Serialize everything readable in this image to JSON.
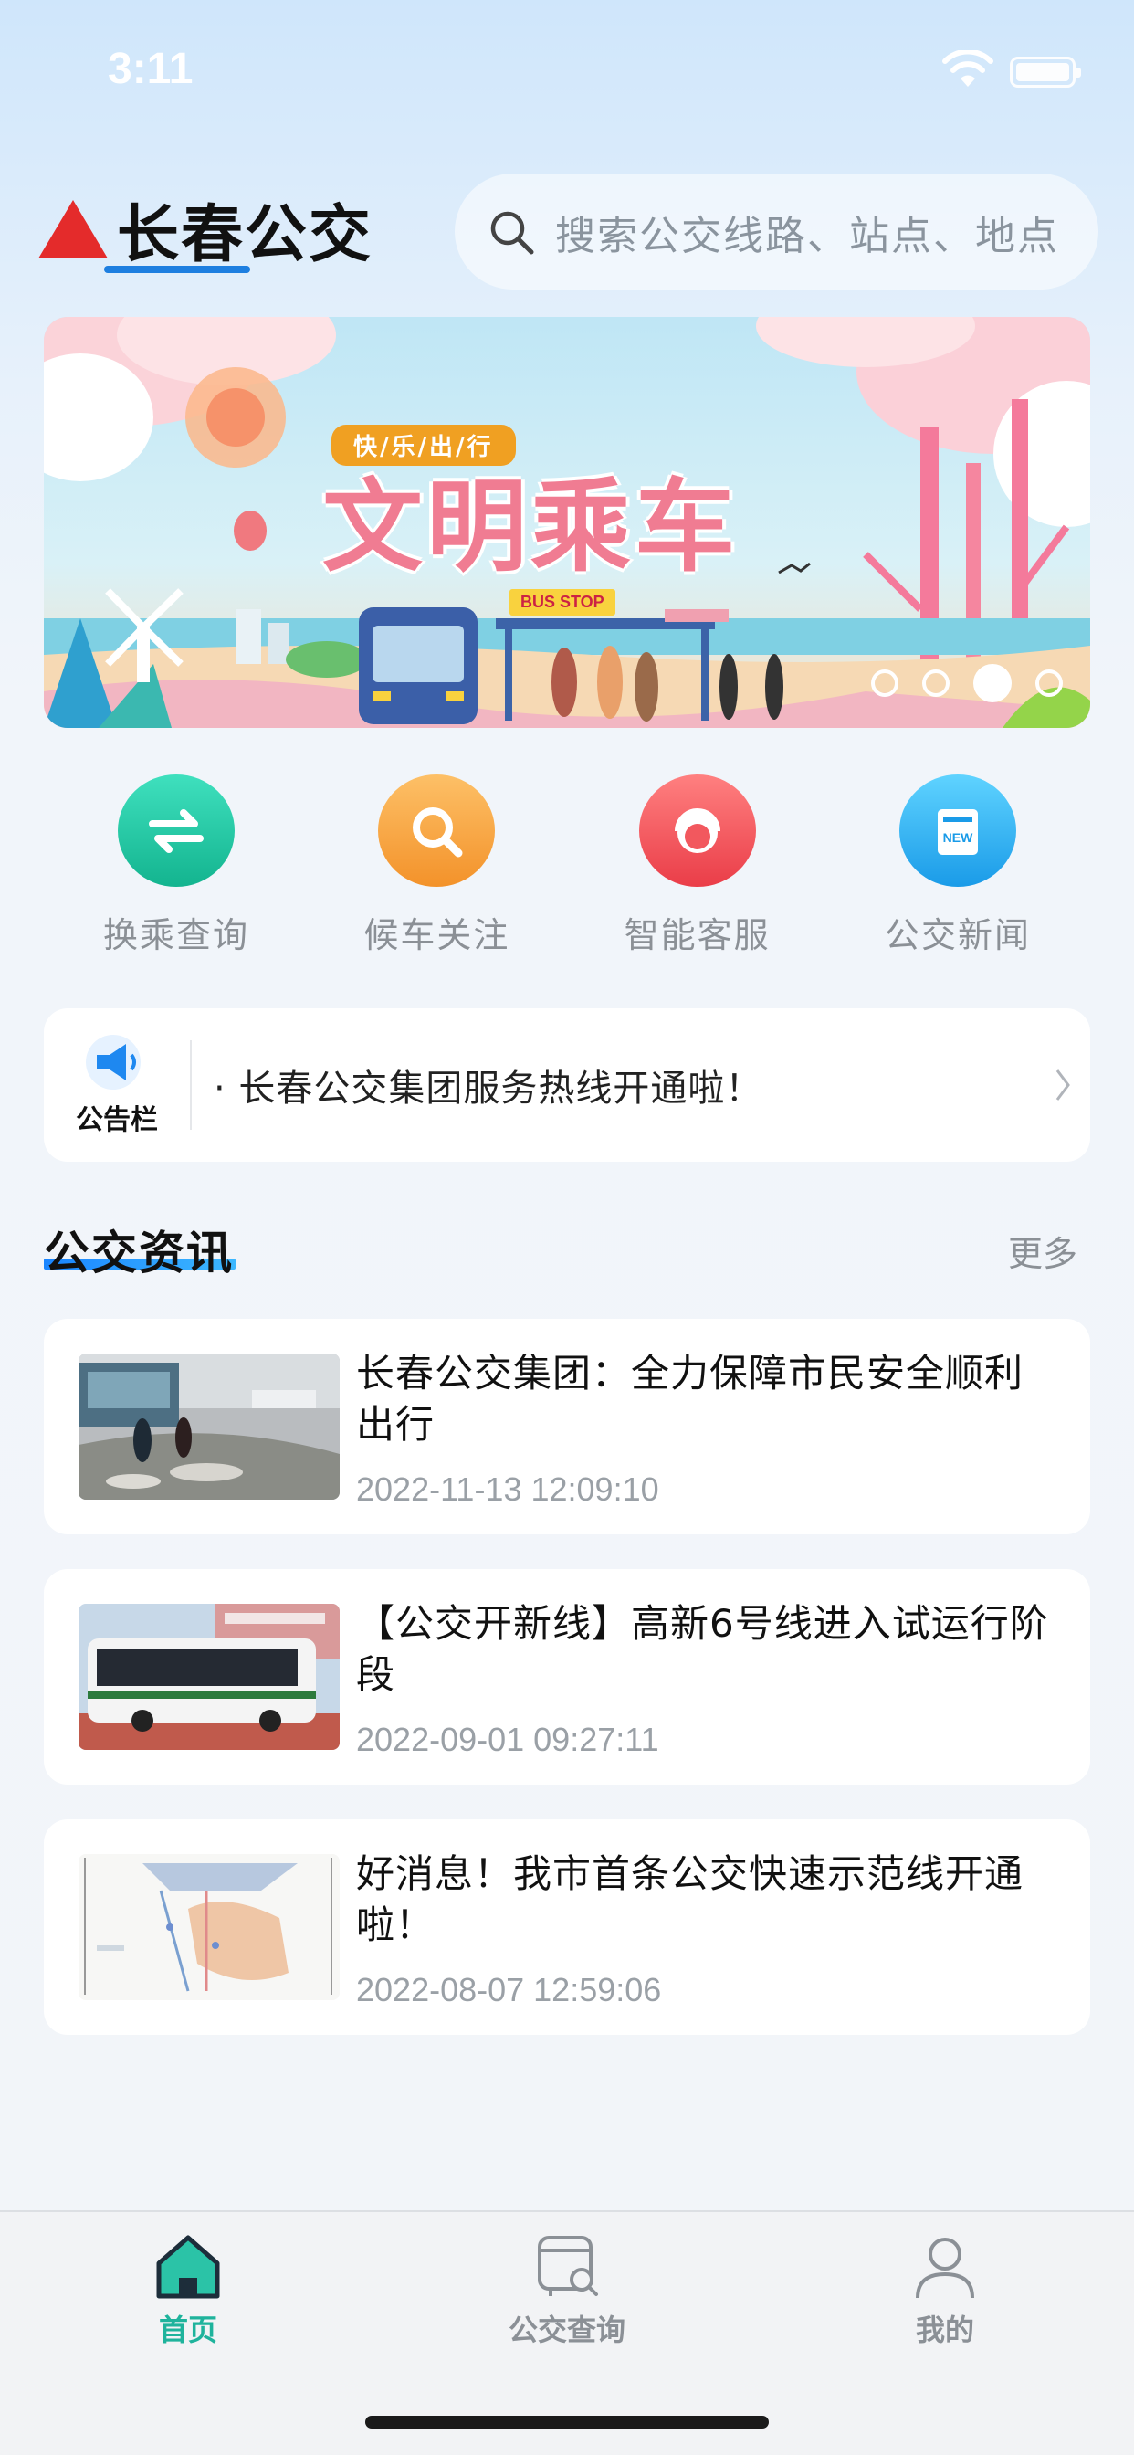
{
  "status_bar": {
    "time": "3:11"
  },
  "header": {
    "logo_text": "长春公交",
    "search_placeholder": "搜索公交线路、站点、地点"
  },
  "banner": {
    "tag": "快/乐/出/行",
    "title": "文明乘车",
    "bus_stop_sign": "BUS STOP",
    "active_dot": 3,
    "dot_count": 4
  },
  "quick_actions": [
    {
      "label": "换乘查询",
      "icon": "transfer-icon",
      "color": "#22c7a6"
    },
    {
      "label": "候车关注",
      "icon": "search-icon",
      "color": "#f7a83a"
    },
    {
      "label": "智能客服",
      "icon": "customer-service-icon",
      "color": "#f2585e"
    },
    {
      "label": "公交新闻",
      "icon": "news-icon",
      "color": "#2fb6f5"
    }
  ],
  "notice": {
    "label": "公告栏",
    "text": "·  长春公交集团服务热线开通啦！"
  },
  "news_section": {
    "title": "公交资讯",
    "more": "更多",
    "items": [
      {
        "title": "长春公交集团：全力保障市民安全顺利出行",
        "date": "2022-11-13 12:09:10"
      },
      {
        "title": "【公交开新线】高新6号线进入试运行阶段",
        "date": "2022-09-01 09:27:11"
      },
      {
        "title": "好消息！我市首条公交快速示范线开通啦！",
        "date": "2022-08-07 12:59:06"
      }
    ]
  },
  "tab_bar": {
    "items": [
      {
        "label": "首页",
        "active": true
      },
      {
        "label": "公交查询",
        "active": false
      },
      {
        "label": "我的",
        "active": false
      }
    ],
    "active_color": "#1fb39c",
    "inactive_color": "#8b9096"
  }
}
